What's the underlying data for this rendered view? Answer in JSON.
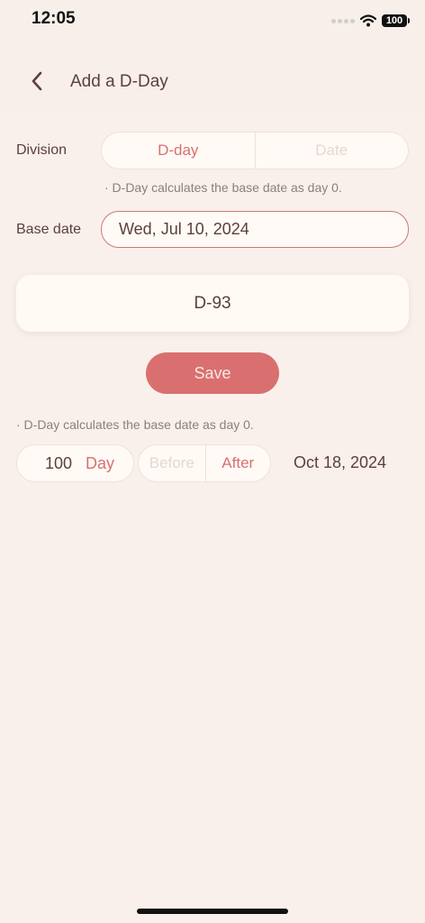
{
  "status": {
    "time": "12:05",
    "battery": "100"
  },
  "header": {
    "title": "Add a D-Day"
  },
  "division": {
    "label": "Division",
    "options": [
      "D-day",
      "Date"
    ],
    "selected": "D-day"
  },
  "note1": "· D-Day calculates the base date as day 0.",
  "base_date": {
    "label": "Base date",
    "value": "Wed, Jul 10, 2024"
  },
  "result_card": {
    "value": "D-93"
  },
  "save_label": "Save",
  "note2": "· D-Day calculates the base date as day 0.",
  "calculator": {
    "amount": "100",
    "unit": "Day",
    "direction_options": [
      "Before",
      "After"
    ],
    "selected_direction": "After",
    "result_date": "Oct 18, 2024"
  },
  "colors": {
    "accent": "#d9706f",
    "background": "#f9f0ec",
    "text": "#5b3f3b"
  }
}
